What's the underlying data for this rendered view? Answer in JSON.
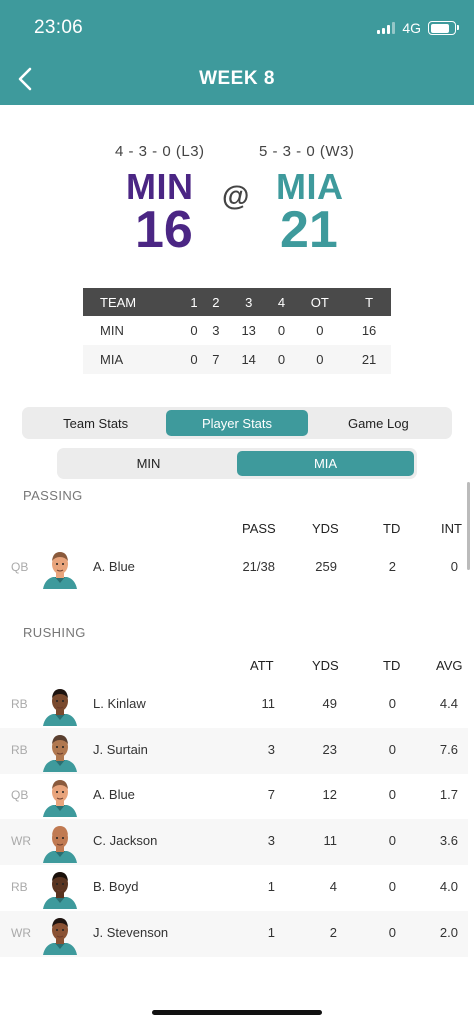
{
  "status": {
    "time": "23:06",
    "network": "4G"
  },
  "nav": {
    "title": "WEEK 8"
  },
  "game": {
    "away": {
      "abbr": "MIN",
      "record": "4 - 3 - 0 (L3)",
      "score": "16"
    },
    "home": {
      "abbr": "MIA",
      "record": "5 - 3 - 0 (W3)",
      "score": "21"
    },
    "at": "@"
  },
  "linescore": {
    "headers": [
      "TEAM",
      "1",
      "2",
      "3",
      "4",
      "OT",
      "T"
    ],
    "rows": [
      [
        "MIN",
        "0",
        "3",
        "13",
        "0",
        "0",
        "16"
      ],
      [
        "MIA",
        "0",
        "7",
        "14",
        "0",
        "0",
        "21"
      ]
    ]
  },
  "tabs": [
    "Team Stats",
    "Player Stats",
    "Game Log"
  ],
  "team_toggle": [
    "MIN",
    "MIA"
  ],
  "passing": {
    "label": "PASSING",
    "columns": [
      "PASS",
      "YDS",
      "TD",
      "INT"
    ],
    "rows": [
      {
        "pos": "QB",
        "name": "A. Blue",
        "values": [
          "21/38",
          "259",
          "2",
          "0"
        ]
      }
    ]
  },
  "rushing": {
    "label": "RUSHING",
    "columns": [
      "ATT",
      "YDS",
      "TD",
      "AVG"
    ],
    "rows": [
      {
        "pos": "RB",
        "name": "L. Kinlaw",
        "values": [
          "11",
          "49",
          "0",
          "4.4"
        ]
      },
      {
        "pos": "RB",
        "name": "J. Surtain",
        "values": [
          "3",
          "23",
          "0",
          "7.6"
        ]
      },
      {
        "pos": "QB",
        "name": "A. Blue",
        "values": [
          "7",
          "12",
          "0",
          "1.7"
        ]
      },
      {
        "pos": "WR",
        "name": "C. Jackson",
        "values": [
          "3",
          "11",
          "0",
          "3.6"
        ]
      },
      {
        "pos": "RB",
        "name": "B. Boyd",
        "values": [
          "1",
          "4",
          "0",
          "4.0"
        ]
      },
      {
        "pos": "WR",
        "name": "J. Stevenson",
        "values": [
          "1",
          "2",
          "0",
          "2.0"
        ]
      }
    ]
  },
  "colors": {
    "header": "#3e9a9c",
    "min": "#4b2684",
    "mia": "#3e9a9c",
    "jersey": "#3e9a9c"
  },
  "avatars": [
    {
      "skin": "#e8a47c",
      "hair": "#8a5a3c"
    },
    {
      "skin": "#7a4a2e",
      "hair": "#1e1410"
    },
    {
      "skin": "#b07850",
      "hair": "#5a3f30"
    },
    {
      "skin": "#e8a47c",
      "hair": "#8a5a3c"
    },
    {
      "skin": "#c07a52",
      "hair": "#c07a52"
    },
    {
      "skin": "#5a3420",
      "hair": "#1a100a"
    },
    {
      "skin": "#8a5234",
      "hair": "#1e1410"
    }
  ]
}
